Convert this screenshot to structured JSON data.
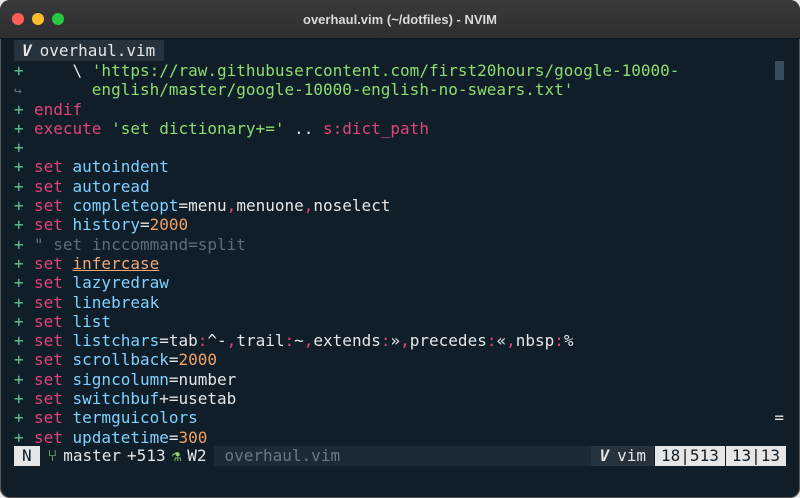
{
  "window": {
    "title": "overhaul.vim (~/dotfiles) - NVIM"
  },
  "tabline": {
    "tab_label": "overhaul.vim",
    "tab_icon": "vim-logo"
  },
  "lines": [
    {
      "sign": "+",
      "parts": [
        {
          "t": "    \\ ",
          "c": "plain"
        },
        {
          "t": "'https://raw.githubusercontent.com/first20hours/google-10000-",
          "c": "str"
        }
      ]
    },
    {
      "sign": "↪",
      "wrap": true,
      "parts": [
        {
          "t": "      english/master/google-10000-english-no-swears.txt'",
          "c": "str"
        }
      ]
    },
    {
      "sign": "+",
      "parts": [
        {
          "t": "endif",
          "c": "kw"
        }
      ]
    },
    {
      "sign": "+",
      "parts": [
        {
          "t": "execute ",
          "c": "kw"
        },
        {
          "t": "'set dictionary+='",
          "c": "str"
        },
        {
          "t": " .. ",
          "c": "plain"
        },
        {
          "t": "s:",
          "c": "var"
        },
        {
          "t": "dict_path",
          "c": "var"
        }
      ]
    },
    {
      "sign": "+",
      "parts": []
    },
    {
      "sign": "+",
      "parts": [
        {
          "t": "set ",
          "c": "kw"
        },
        {
          "t": "autoindent",
          "c": "opt"
        }
      ]
    },
    {
      "sign": "+",
      "parts": [
        {
          "t": "set ",
          "c": "kw"
        },
        {
          "t": "autoread",
          "c": "opt"
        }
      ]
    },
    {
      "sign": "+",
      "parts": [
        {
          "t": "set ",
          "c": "kw"
        },
        {
          "t": "completeopt",
          "c": "opt"
        },
        {
          "t": "=menu",
          "c": "plain"
        },
        {
          "t": ",",
          "c": "kw"
        },
        {
          "t": "menuone",
          "c": "plain"
        },
        {
          "t": ",",
          "c": "kw"
        },
        {
          "t": "noselect",
          "c": "plain"
        }
      ]
    },
    {
      "sign": "+",
      "parts": [
        {
          "t": "set ",
          "c": "kw"
        },
        {
          "t": "history",
          "c": "opt"
        },
        {
          "t": "=",
          "c": "plain"
        },
        {
          "t": "2000",
          "c": "num"
        }
      ]
    },
    {
      "sign": "+",
      "parts": [
        {
          "t": "\" set inccommand=split",
          "c": "cmt"
        }
      ]
    },
    {
      "sign": "+",
      "parts": [
        {
          "t": "set ",
          "c": "kw"
        },
        {
          "t": "infercase",
          "c": "under"
        }
      ]
    },
    {
      "sign": "+",
      "parts": [
        {
          "t": "set ",
          "c": "kw"
        },
        {
          "t": "lazyredraw",
          "c": "opt"
        }
      ]
    },
    {
      "sign": "+",
      "parts": [
        {
          "t": "set ",
          "c": "kw"
        },
        {
          "t": "linebreak",
          "c": "opt"
        }
      ]
    },
    {
      "sign": "+",
      "parts": [
        {
          "t": "set ",
          "c": "kw"
        },
        {
          "t": "list",
          "c": "opt"
        }
      ]
    },
    {
      "sign": "+",
      "parts": [
        {
          "t": "set ",
          "c": "kw"
        },
        {
          "t": "listchars",
          "c": "opt"
        },
        {
          "t": "=tab",
          "c": "plain"
        },
        {
          "t": ":",
          "c": "kw"
        },
        {
          "t": "^-",
          "c": "plain"
        },
        {
          "t": ",",
          "c": "kw"
        },
        {
          "t": "trail",
          "c": "plain"
        },
        {
          "t": ":",
          "c": "kw"
        },
        {
          "t": "~",
          "c": "plain"
        },
        {
          "t": ",",
          "c": "kw"
        },
        {
          "t": "extends",
          "c": "plain"
        },
        {
          "t": ":",
          "c": "kw"
        },
        {
          "t": "»",
          "c": "plain"
        },
        {
          "t": ",",
          "c": "kw"
        },
        {
          "t": "precedes",
          "c": "plain"
        },
        {
          "t": ":",
          "c": "kw"
        },
        {
          "t": "«",
          "c": "plain"
        },
        {
          "t": ",",
          "c": "kw"
        },
        {
          "t": "nbsp",
          "c": "plain"
        },
        {
          "t": ":",
          "c": "kw"
        },
        {
          "t": "%",
          "c": "plain"
        }
      ]
    },
    {
      "sign": "+",
      "parts": [
        {
          "t": "set ",
          "c": "kw"
        },
        {
          "t": "scrollback",
          "c": "opt"
        },
        {
          "t": "=",
          "c": "plain"
        },
        {
          "t": "2000",
          "c": "num"
        }
      ]
    },
    {
      "sign": "+",
      "parts": [
        {
          "t": "set ",
          "c": "kw"
        },
        {
          "t": "signcolumn",
          "c": "opt"
        },
        {
          "t": "=number",
          "c": "plain"
        }
      ]
    },
    {
      "sign": "+",
      "parts": [
        {
          "t": "set ",
          "c": "kw"
        },
        {
          "t": "switchbuf",
          "c": "opt"
        },
        {
          "t": "+=usetab",
          "c": "plain"
        }
      ]
    },
    {
      "sign": "+",
      "parts": [
        {
          "t": "set ",
          "c": "kw"
        },
        {
          "t": "termguicolors",
          "c": "opt"
        }
      ]
    },
    {
      "sign": "+",
      "parts": [
        {
          "t": "set ",
          "c": "kw"
        },
        {
          "t": "updatetime",
          "c": "opt"
        },
        {
          "t": "=",
          "c": "plain"
        },
        {
          "t": "300",
          "c": "num"
        }
      ]
    }
  ],
  "right_marker": "=",
  "statusline": {
    "mode": "N",
    "branch_icon": "git-branch-icon",
    "branch": "master",
    "diff": "+513",
    "diag_icon": "flask-icon",
    "warnings": "W2",
    "filename": "overhaul.vim",
    "filetype": "vim",
    "position": "18|513",
    "column": "13|13"
  },
  "colors": {
    "bg": "#0f1e29",
    "keyword": "#e0447a",
    "option": "#7fd1ff",
    "string": "#8fdc6e",
    "number": "#f4a261",
    "sign": "#5fc48a"
  }
}
